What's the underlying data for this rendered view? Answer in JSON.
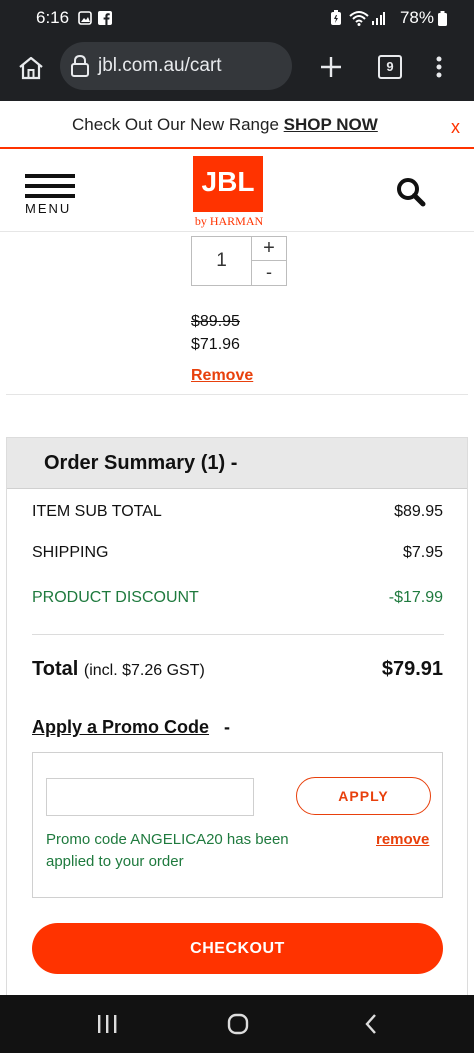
{
  "status_bar": {
    "time": "6:16",
    "battery": "78%"
  },
  "browser": {
    "url": "jbl.com.au/cart",
    "tab_count": "9"
  },
  "promo_banner": {
    "text": "Check Out Our New Range",
    "link": "SHOP NOW",
    "close": "x"
  },
  "header": {
    "menu_label": "MENU",
    "logo_text": "JBL",
    "logo_sub": "by HARMAN"
  },
  "cart_item": {
    "quantity": "1",
    "plus": "+",
    "minus": "-",
    "original_price": "$89.95",
    "sale_price": "$71.96",
    "remove_label": "Remove"
  },
  "summary": {
    "title": "Order Summary (1) -",
    "rows": [
      {
        "label": "ITEM SUB TOTAL",
        "value": "$89.95"
      },
      {
        "label": "SHIPPING",
        "value": "$7.95"
      },
      {
        "label": "PRODUCT DISCOUNT",
        "value": "-$17.99"
      }
    ],
    "total_label": "Total",
    "total_note": "(incl. $7.26 GST)",
    "total_value": "$79.91",
    "promo_heading": "Apply a Promo Code",
    "promo_toggle": "-",
    "promo_input_value": "",
    "apply_label": "APPLY",
    "promo_applied_text": "Promo code ANGELICA20 has been applied to your order",
    "promo_remove_label": "remove",
    "checkout_label": "CHECKOUT"
  },
  "colors": {
    "accent": "#ff3300",
    "green": "#1f7a3e",
    "dark": "#1f2124"
  }
}
